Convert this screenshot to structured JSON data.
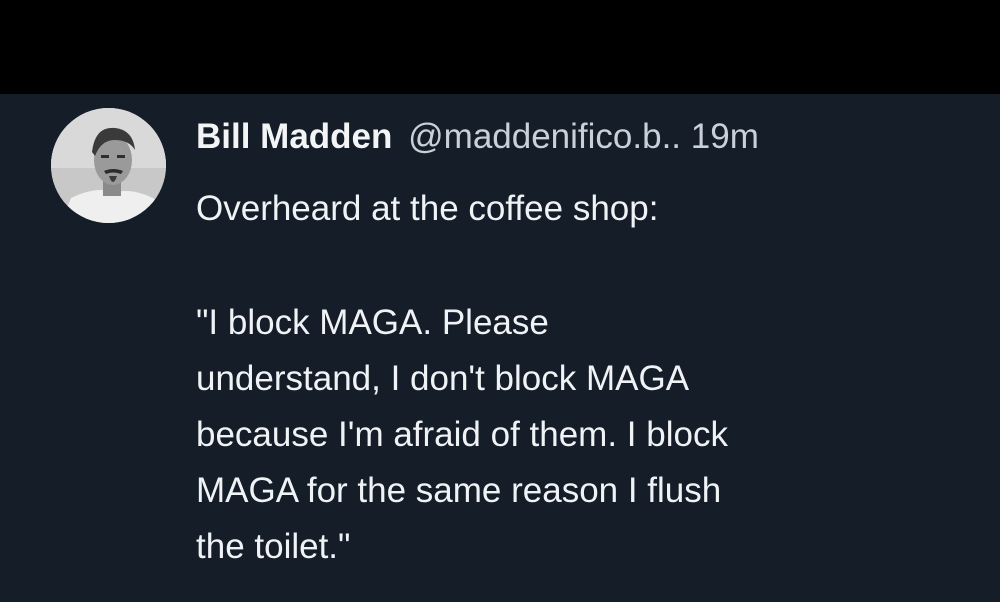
{
  "post": {
    "author_name": "Bill Madden",
    "author_handle": "@maddenifico.b..",
    "time_separator": "",
    "timestamp": "19m",
    "avatar_icon": "user-photo-avatar",
    "body_lines": [
      "Overheard at the coffee shop:",
      "",
      "\"I block MAGA. Please",
      "understand, I don't block MAGA",
      "because I'm afraid of them. I block",
      "MAGA for the same reason I flush",
      "the toilet.\""
    ]
  },
  "colors": {
    "background": "#151e28",
    "top_bar": "#000000",
    "text": "#f0f3f6"
  }
}
